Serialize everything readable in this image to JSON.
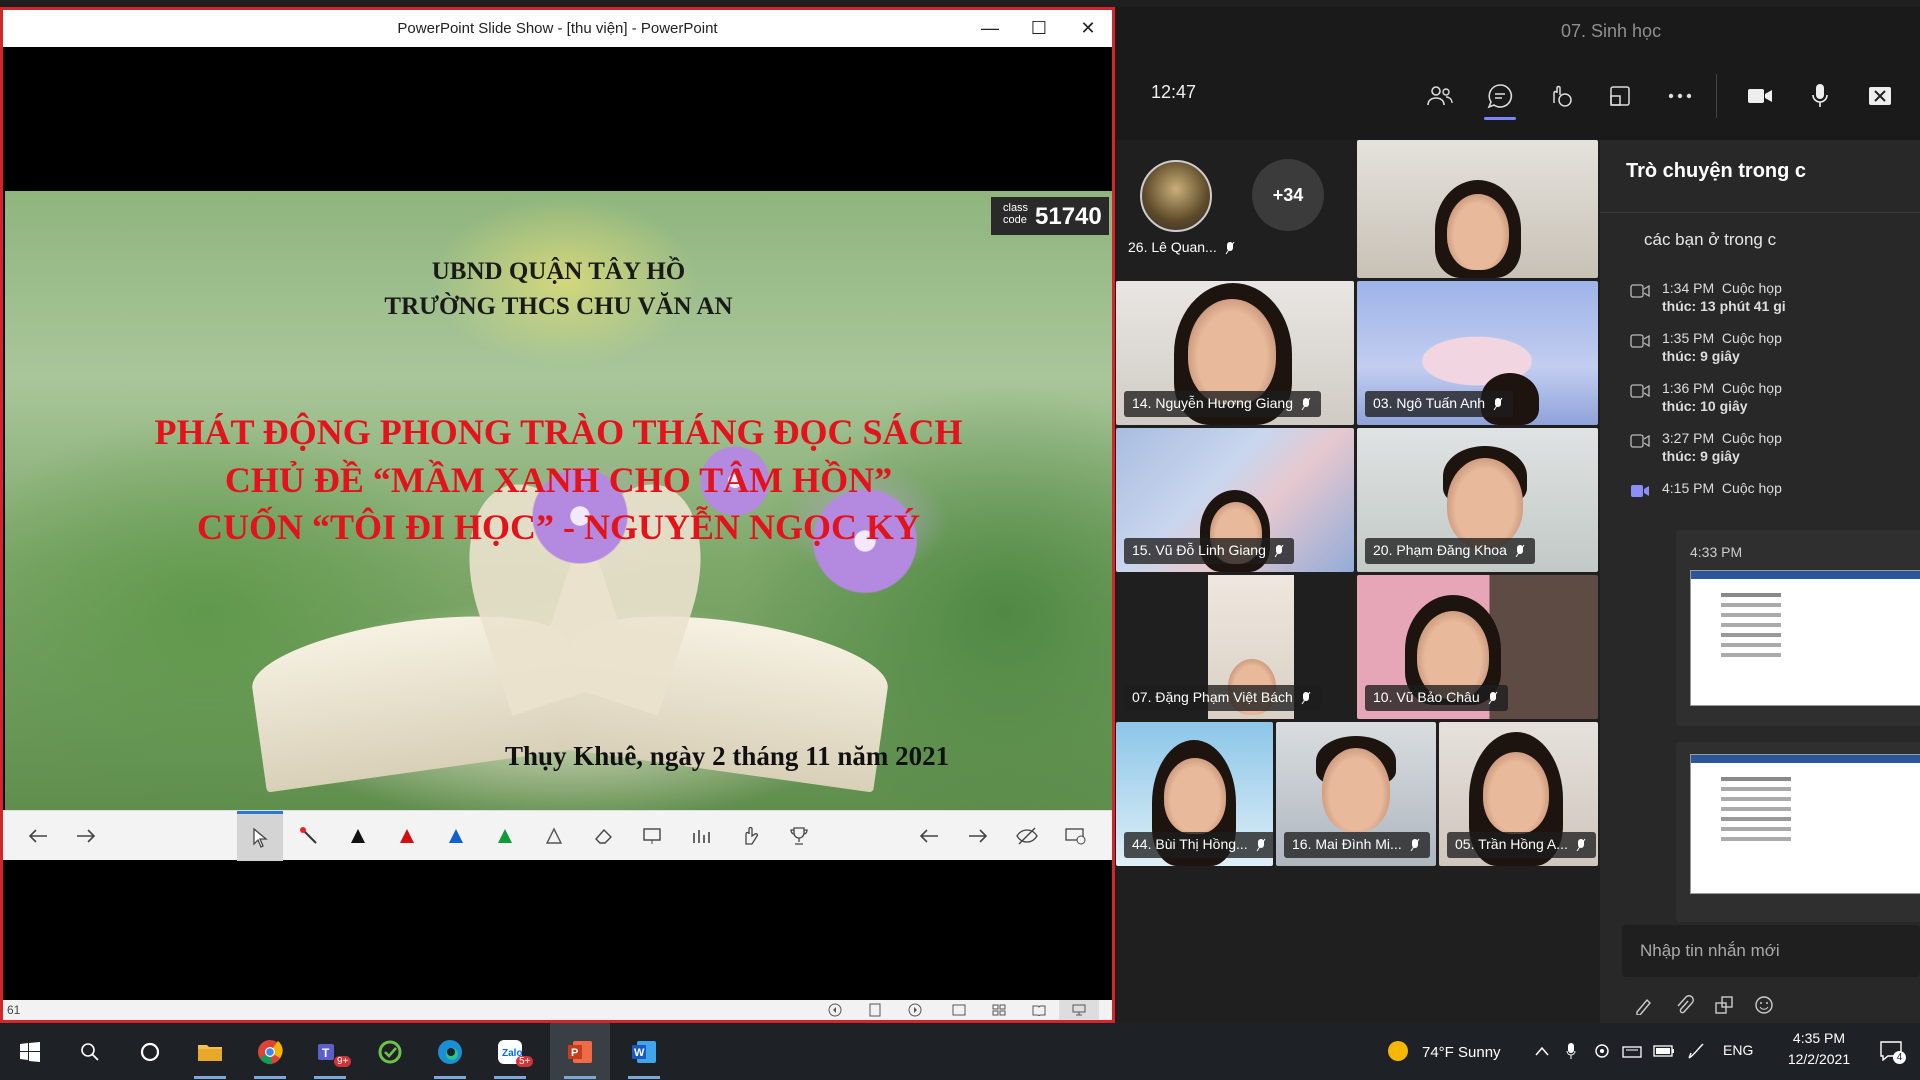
{
  "ppt": {
    "window_title": "PowerPoint Slide Show - [thu viện] - PowerPoint",
    "minimize": "—",
    "maximize": "☐",
    "close": "✕",
    "slide": {
      "line1": "UBND QUẬN TÂY HỒ",
      "line2": "TRƯỜNG THCS CHU VĂN AN",
      "headline1": "PHÁT ĐỘNG PHONG TRÀO THÁNG ĐỌC SÁCH",
      "headline2": "CHỦ ĐỀ “MẦM XANH CHO TÂM HỒN”",
      "headline3": "CUỐN “TÔI ĐI HỌC”  - NGUYỄN NGỌC KÝ",
      "footer": "Thụy Khuê, ngày 2 tháng 11 năm 2021",
      "headline_color": "#e4121a"
    },
    "class_code_label1": "class",
    "class_code_label2": "code",
    "class_code": "51740",
    "status_page": "61"
  },
  "teams": {
    "window_title": "07. Sinh học",
    "clock": "12:47",
    "accent": "#7f85f5",
    "roster": {
      "name": "26. Lê Quan...",
      "more": "+34"
    },
    "participants": [
      "14. Nguyễn Hương Giang",
      "03. Ngô Tuấn Anh",
      "15. Vũ Đỗ Linh Giang",
      "20. Phạm Đăng Khoa",
      "07. Đặng Phạm Việt Bách",
      "10. Vũ Bảo Châu",
      "44. Bùi Thị Hồng...",
      "16. Mai Đình Mi...",
      "05. Trần Hồng A..."
    ],
    "chat": {
      "title": "Trò chuyện trong c",
      "first_message": "các bạn ở trong c",
      "events": [
        {
          "time": "1:34 PM",
          "text": "Cuộc họp",
          "line2": "thúc: 13 phút 41 gi"
        },
        {
          "time": "1:35 PM",
          "text": "Cuộc họp",
          "line2": "thúc: 9 giây"
        },
        {
          "time": "1:36 PM",
          "text": "Cuộc họp",
          "line2": "thúc: 10 giây"
        },
        {
          "time": "3:27 PM",
          "text": "Cuộc họp",
          "line2": "thúc: 9 giây"
        },
        {
          "time": "4:15 PM",
          "text": "Cuộc họp",
          "line2": ""
        }
      ],
      "message_time": "4:33 PM",
      "input_placeholder": "Nhập tin nhắn mới"
    }
  },
  "taskbar": {
    "weather": "74°F  Sunny",
    "lang": "ENG",
    "time": "4:35 PM",
    "date": "12/2/2021",
    "teams_badge": "9+",
    "zalo_badge": "5+",
    "notif_count": "4"
  }
}
